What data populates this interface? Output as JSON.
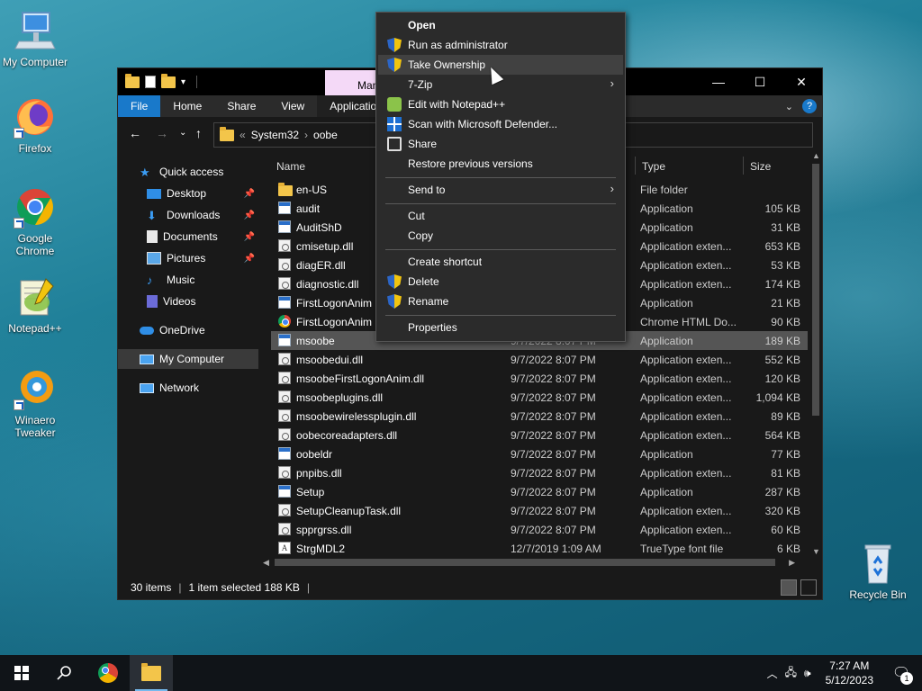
{
  "desktop": {
    "icons": [
      {
        "label": "My Computer"
      },
      {
        "label": "Firefox"
      },
      {
        "label": "Google Chrome"
      },
      {
        "label": "Notepad++"
      },
      {
        "label": "Winaero Tweaker"
      },
      {
        "label": "Recycle Bin"
      }
    ]
  },
  "window": {
    "manage_tab": "Manage",
    "ribbon_tabs": [
      "File",
      "Home",
      "Share",
      "View",
      "Application Tools"
    ],
    "help": "?",
    "path": [
      "System32",
      "oobe"
    ],
    "path_prefix": "«"
  },
  "nav": {
    "items": [
      {
        "label": "Quick access"
      },
      {
        "label": "Desktop"
      },
      {
        "label": "Downloads"
      },
      {
        "label": "Documents"
      },
      {
        "label": "Pictures"
      },
      {
        "label": "Music"
      },
      {
        "label": "Videos"
      },
      {
        "label": "OneDrive"
      },
      {
        "label": "My Computer"
      },
      {
        "label": "Network"
      }
    ]
  },
  "list": {
    "headers": {
      "name": "Name",
      "type": "Type",
      "size": "Size"
    },
    "rows": [
      {
        "name": "en-US",
        "date": "",
        "type": "File folder",
        "size": "",
        "icon": "folder-icon"
      },
      {
        "name": "audit",
        "date": "",
        "type": "Application",
        "size": "105 KB",
        "icon": "app-icon"
      },
      {
        "name": "AuditShD",
        "date": "",
        "type": "Application",
        "size": "31 KB",
        "icon": "app-icon"
      },
      {
        "name": "cmisetup.dll",
        "date": "",
        "type": "Application exten...",
        "size": "653 KB",
        "icon": "dll-icon"
      },
      {
        "name": "diagER.dll",
        "date": "",
        "type": "Application exten...",
        "size": "53 KB",
        "icon": "dll-icon"
      },
      {
        "name": "diagnostic.dll",
        "date": "",
        "type": "Application exten...",
        "size": "174 KB",
        "icon": "dll-icon"
      },
      {
        "name": "FirstLogonAnim",
        "date": "",
        "type": "Application",
        "size": "21 KB",
        "icon": "app-icon"
      },
      {
        "name": "FirstLogonAnim",
        "date": "",
        "type": "Chrome HTML Do...",
        "size": "90 KB",
        "icon": "chrome-icon"
      },
      {
        "name": "msoobe",
        "date": "9/7/2022 8:07 PM",
        "type": "Application",
        "size": "189 KB",
        "icon": "app-icon",
        "selected": true
      },
      {
        "name": "msoobedui.dll",
        "date": "9/7/2022 8:07 PM",
        "type": "Application exten...",
        "size": "552 KB",
        "icon": "dll-icon"
      },
      {
        "name": "msoobeFirstLogonAnim.dll",
        "date": "9/7/2022 8:07 PM",
        "type": "Application exten...",
        "size": "120 KB",
        "icon": "dll-icon"
      },
      {
        "name": "msoobeplugins.dll",
        "date": "9/7/2022 8:07 PM",
        "type": "Application exten...",
        "size": "1,094 KB",
        "icon": "dll-icon"
      },
      {
        "name": "msoobewirelessplugin.dll",
        "date": "9/7/2022 8:07 PM",
        "type": "Application exten...",
        "size": "89 KB",
        "icon": "dll-icon"
      },
      {
        "name": "oobecoreadapters.dll",
        "date": "9/7/2022 8:07 PM",
        "type": "Application exten...",
        "size": "564 KB",
        "icon": "dll-icon"
      },
      {
        "name": "oobeldr",
        "date": "9/7/2022 8:07 PM",
        "type": "Application",
        "size": "77 KB",
        "icon": "app-icon"
      },
      {
        "name": "pnpibs.dll",
        "date": "9/7/2022 8:07 PM",
        "type": "Application exten...",
        "size": "81 KB",
        "icon": "dll-icon"
      },
      {
        "name": "Setup",
        "date": "9/7/2022 8:07 PM",
        "type": "Application",
        "size": "287 KB",
        "icon": "setup-icon"
      },
      {
        "name": "SetupCleanupTask.dll",
        "date": "9/7/2022 8:07 PM",
        "type": "Application exten...",
        "size": "320 KB",
        "icon": "dll-icon"
      },
      {
        "name": "spprgrss.dll",
        "date": "9/7/2022 8:07 PM",
        "type": "Application exten...",
        "size": "60 KB",
        "icon": "dll-icon"
      },
      {
        "name": "StrgMDL2",
        "date": "12/7/2019 1:09 AM",
        "type": "TrueType font file",
        "size": "6 KB",
        "icon": "font-icon"
      }
    ]
  },
  "status": {
    "count": "30 items",
    "selection": "1 item selected  188 KB"
  },
  "context_menu": {
    "items": [
      {
        "label": "Open",
        "bold": true
      },
      {
        "label": "Run as administrator",
        "icon": "shield-icon"
      },
      {
        "label": "Take Ownership",
        "icon": "shield-icon",
        "hover": true
      },
      {
        "label": "7-Zip",
        "submenu": true
      },
      {
        "label": "Edit with Notepad++",
        "icon": "notepadpp-icon"
      },
      {
        "label": "Scan with Microsoft Defender...",
        "icon": "defender-icon"
      },
      {
        "label": "Share",
        "icon": "share-icon"
      },
      {
        "label": "Restore previous versions"
      },
      {
        "label": "Send to",
        "submenu": true
      },
      {
        "label": "Cut"
      },
      {
        "label": "Copy"
      },
      {
        "label": "Create shortcut"
      },
      {
        "label": "Delete",
        "icon": "shield-icon"
      },
      {
        "label": "Rename",
        "icon": "shield-icon"
      },
      {
        "label": "Properties"
      }
    ]
  },
  "taskbar": {
    "time": "7:27 AM",
    "date": "5/12/2023",
    "notif_count": "1"
  },
  "colors": {
    "accent": "#1979ca",
    "selection": "#555555",
    "menu_bg": "#2b2b2b"
  }
}
